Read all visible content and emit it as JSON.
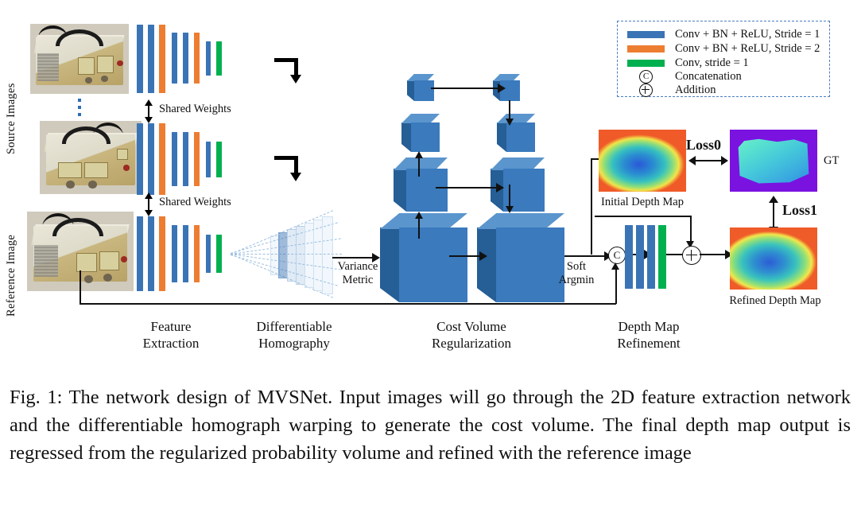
{
  "figure": {
    "side_labels": {
      "source_images": "Source Images",
      "reference_image": "Reference Image"
    },
    "shared_weights_labels": [
      "Shared Weights",
      "Shared Weights"
    ],
    "inline_labels": {
      "variance_metric_line1": "Variance",
      "variance_metric_line2": "Metric",
      "soft_argmin_line1": "Soft",
      "soft_argmin_line2": "Argmin",
      "initial_depth_map": "Initial Depth Map",
      "refined_depth_map": "Refined Depth Map",
      "ground_truth": "GT",
      "loss0": "Loss0",
      "loss1": "Loss1",
      "concat_symbol": "C",
      "addition_symbol": "+"
    },
    "stage_labels": [
      {
        "line1": "Feature",
        "line2": "Extraction"
      },
      {
        "line1": "Differentiable",
        "line2": "Homography"
      },
      {
        "line1": "Cost Volume",
        "line2": "Regularization"
      },
      {
        "line1": "Depth Map",
        "line2": "Refinement"
      }
    ],
    "legend": {
      "rows": [
        {
          "type": "swatch",
          "color": "#3a74b5",
          "label": "Conv + BN + ReLU, Stride = 1"
        },
        {
          "type": "swatch",
          "color": "#ed7d31",
          "label": "Conv + BN + ReLU, Stride = 2"
        },
        {
          "type": "swatch",
          "color": "#00b04f",
          "label": "Conv, stride = 1"
        },
        {
          "type": "symbol",
          "symbol": "C",
          "label": "Concatenation"
        },
        {
          "type": "symbol",
          "symbol": "+",
          "label": "Addition"
        }
      ]
    },
    "colors": {
      "conv_stride1": "#3a74b5",
      "conv_stride2": "#ed7d31",
      "conv_plain": "#00b04f",
      "cube_front": "#3a7abd",
      "cube_top": "#5b95cd",
      "cube_left": "#265e96",
      "legend_border": "#4a7fc1"
    }
  },
  "caption": {
    "full": "Fig. 1: The network design of MVSNet. Input images will go through the 2D feature extraction network and the differentiable homograph warping to generate the cost volume. The final depth map output is regressed from the regularized probability volume and refined with the reference image"
  }
}
